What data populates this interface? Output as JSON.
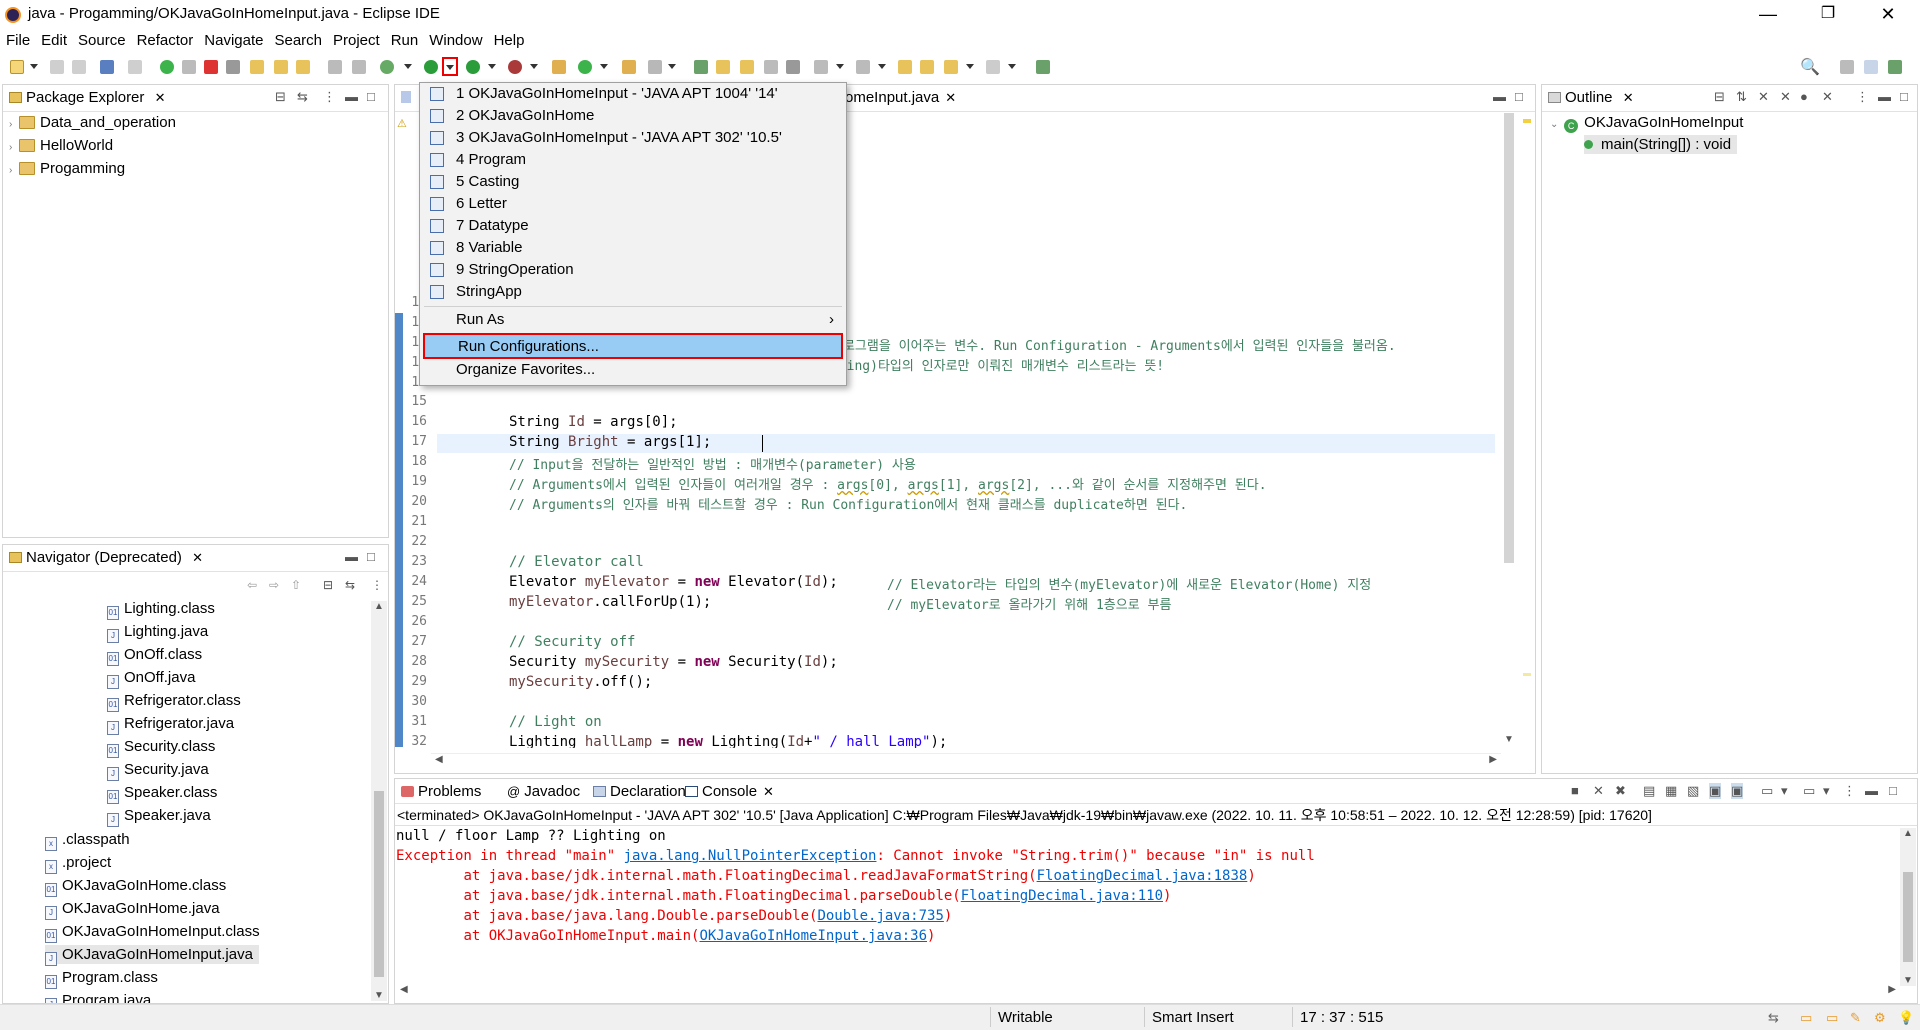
{
  "window": {
    "title": "java - Progamming/OKJavaGoInHomeInput.java - Eclipse IDE",
    "min": "—",
    "restore": "❐",
    "close": "✕"
  },
  "menu": [
    "File",
    "Edit",
    "Source",
    "Refactor",
    "Navigate",
    "Search",
    "Project",
    "Run",
    "Window",
    "Help"
  ],
  "package_explorer": {
    "title": "Package Explorer",
    "items": [
      "Data_and_operation",
      "HelloWorld",
      "Progamming"
    ]
  },
  "navigator": {
    "title": "Navigator (Deprecated)",
    "items": [
      "Lighting.class",
      "Lighting.java",
      "OnOff.class",
      "OnOff.java",
      "Refrigerator.class",
      "Refrigerator.java",
      "Security.class",
      "Security.java",
      "Speaker.class",
      "Speaker.java"
    ],
    "root_items": [
      ".classpath",
      ".project",
      "OKJavaGoInHome.class",
      "OKJavaGoInHome.java",
      "OKJavaGoInHomeInput.class",
      "OKJavaGoInHomeInput.java",
      "Program.class",
      "Program.java"
    ],
    "selected": "OKJavaGoInHomeInput.java"
  },
  "editor": {
    "tab_label": "omeInput.java",
    "lines": [
      {
        "n": "16",
        "html": "        <span class=\"kw\"></span>String <span class=\"vr\">Id</span> = args[0];"
      },
      {
        "n": "17",
        "html": "        String <span class=\"vr\">Bright</span> = args[1];"
      }
    ],
    "line_numbers": [
      "10",
      "11",
      "12",
      "13",
      "14",
      "15",
      "16",
      "17",
      "18",
      "19",
      "20",
      "21",
      "22",
      "23",
      "24",
      "25",
      "26",
      "27",
      "28",
      "29",
      "30",
      "31",
      "32"
    ],
    "behind_text_1": "프로그램을 이어주는 변수. Run Configuration - Arguments에서 입력된 인자들을 불러옴.",
    "behind_text_2": "tring)타입의 인자로만 이뤄진 매개변수 리스트라는 뜻!",
    "code": {
      "l16a": "String ",
      "l16b": "Id",
      "l16c": " = args[0];",
      "l17a": "String ",
      "l17b": "Bright",
      "l17c": " = args[1];",
      "l18": "// Input을 전달하는 일반적인 방법 : 매개변수(parameter) 사용",
      "l19a": "// Arguments에서 입력된 인자들이 여러개일 경우 : ",
      "l19b": "args",
      "l19c": "[0], ",
      "l19d": "args",
      "l19e": "[1], ",
      "l19f": "args",
      "l19g": "[2], ...와 같이 순서를 지정해주면 된다.",
      "l20": "// Arguments의 인자를 바꿔 테스트할 경우 : Run Configuration에서 현재 클래스를 duplicate하면 된다.",
      "l23": "// Elevator call",
      "l24a": "Elevator ",
      "l24b": "myElevator",
      "l24c": " = ",
      "l24d": "new",
      "l24e": " Elevator(",
      "l24f": "Id",
      "l24g": ");",
      "l24h": "// Elevator라는 타입의 변수(myElevator)에 새로운 Elevator(Home) 지정",
      "l25a": "myElevator",
      "l25b": ".callForUp(1);",
      "l25c": "// myElevator로 올라가기 위해 1층으로 부름",
      "l27": "// Security off",
      "l28a": "Security ",
      "l28b": "mySecurity",
      "l28c": " = ",
      "l28d": "new",
      "l28e": " Security(",
      "l28f": "Id",
      "l28g": ");",
      "l29a": "mySecurity",
      "l29b": ".off();",
      "l31": "// Light on",
      "l32a": "Lighting ",
      "l32b": "hallLamp",
      "l32c": " = ",
      "l32d": "new",
      "l32e": " Lighting(",
      "l32f": "Id",
      "l32g": "+",
      "l32h": "\" / hall Lamp\"",
      "l32i": ");"
    }
  },
  "run_menu": {
    "items": [
      "1 OKJavaGoInHomeInput - 'JAVA APT 1004' '14'",
      "2 OKJavaGoInHome",
      "3 OKJavaGoInHomeInput - 'JAVA APT 302' '10.5'",
      "4 Program",
      "5 Casting",
      "6 Letter",
      "7 Datatype",
      "8 Variable",
      "9 StringOperation",
      "StringApp"
    ],
    "run_as": "Run As",
    "run_configurations": "Run Configurations...",
    "organize_favorites": "Organize Favorites..."
  },
  "outline": {
    "title": "Outline",
    "class_name": "OKJavaGoInHomeInput",
    "method": "main(String[]) : void"
  },
  "bottom_tabs": [
    "Problems",
    "Javadoc",
    "Declaration",
    "Console"
  ],
  "console": {
    "header": "<terminated> OKJavaGoInHomeInput - 'JAVA APT 302' '10.5' [Java Application] C:₩Program Files₩Java₩jdk-19₩bin₩javaw.exe  (2022. 10. 11. 오후 10:58:51 – 2022. 10. 12. 오전 12:28:59) [pid: 17620]",
    "line1": "null / floor Lamp ?? Lighting on",
    "err1a": "Exception in thread \"main\" ",
    "err1b": "java.lang.NullPointerException",
    "err1c": ": Cannot invoke \"String.trim()\" because \"in\" is null",
    "err2a": "\tat java.base/jdk.internal.math.FloatingDecimal.readJavaFormatString(",
    "err2b": "FloatingDecimal.java:1838",
    "err3a": "\tat java.base/jdk.internal.math.FloatingDecimal.parseDouble(",
    "err3b": "FloatingDecimal.java:110",
    "err4a": "\tat java.base/java.lang.Double.parseDouble(",
    "err4b": "Double.java:735",
    "err5a": "\tat OKJavaGoInHomeInput.main(",
    "err5b": "OKJavaGoInHomeInput.java:36",
    "close_paren": ")"
  },
  "status": {
    "writable": "Writable",
    "insert": "Smart Insert",
    "position": "17 : 37 : 515"
  }
}
